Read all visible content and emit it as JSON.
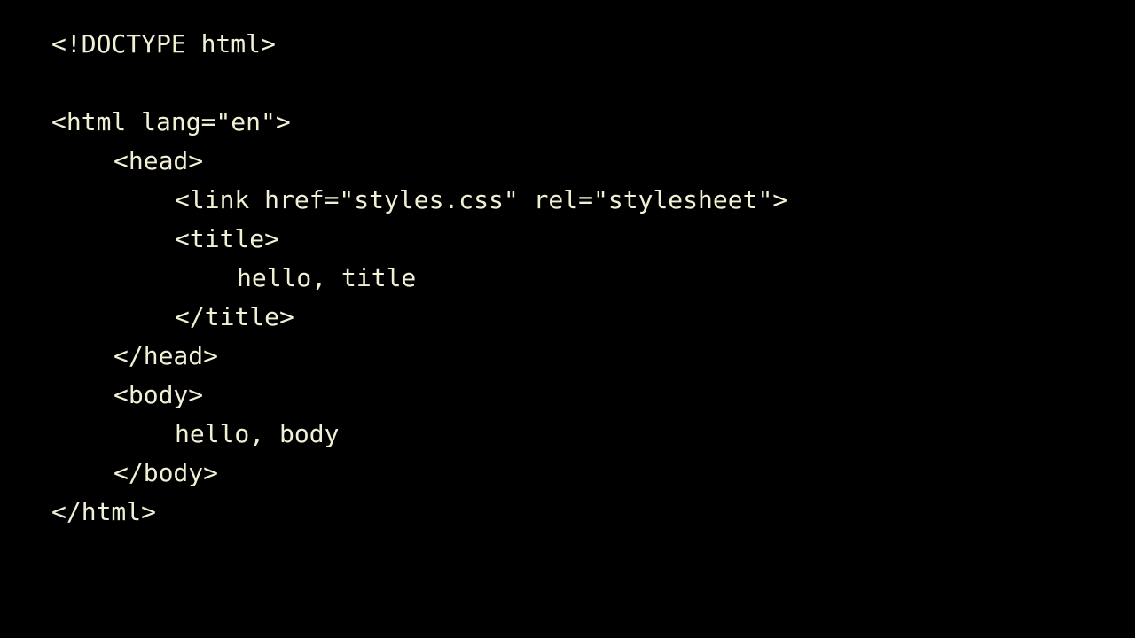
{
  "code": {
    "lines": [
      "<!DOCTYPE html>",
      "",
      "<html lang=\"en\">",
      "<head>",
      "<link href=\"styles.css\" rel=\"stylesheet\">",
      "<title>",
      "hello, title",
      "</title>",
      "</head>",
      "<body>",
      "hello, body",
      "</body>",
      "</html>"
    ]
  },
  "colors": {
    "background": "#000000",
    "text": "#f2f0d4"
  }
}
